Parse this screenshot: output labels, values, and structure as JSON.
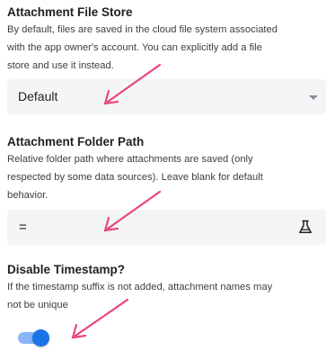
{
  "attachment_file_store": {
    "title": "Attachment File Store",
    "desc_line1": "By default, files are saved in the cloud file system associated",
    "desc_line2": "with the app owner's account. You can explicitly add a file",
    "desc_line3": "store and use it instead.",
    "selected_value": "Default"
  },
  "attachment_folder_path": {
    "title": "Attachment Folder Path",
    "desc_line1": "Relative folder path where attachments are saved (only",
    "desc_line2": "respected by some data sources). Leave blank for default",
    "desc_line3": "behavior.",
    "value": "="
  },
  "disable_timestamp": {
    "title": "Disable Timestamp?",
    "desc_line1": "If the timestamp suffix is not added, attachment names may",
    "desc_line2": "not be unique",
    "toggle_on": true
  },
  "colors": {
    "annotation_arrow": "#e8457b",
    "toggle_knob": "#1a73e8",
    "toggle_track": "#8ab4f8",
    "field_background": "#f4f5f7"
  },
  "icons": {
    "dropdown": "chevron-down-icon",
    "expression": "flask-icon"
  }
}
